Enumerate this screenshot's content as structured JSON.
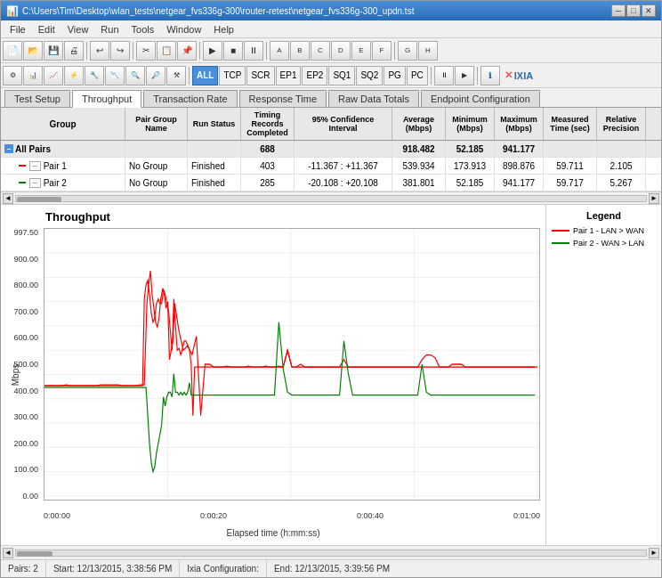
{
  "window": {
    "title": "C:\\Users\\Tim\\Desktop\\wlan_tests\\netgear_fvs336g-300\\router-retest\\netgear_fvs336g-300_updn.tst",
    "title_short": "netgear_fvs336g-300_updn.tst"
  },
  "menu": {
    "items": [
      "File",
      "Edit",
      "View",
      "Run",
      "Tools",
      "Window",
      "Help"
    ]
  },
  "toolbar": {
    "protocols": [
      "ALL",
      "TCP",
      "SCR",
      "EP1",
      "EP2",
      "SQ1",
      "SQ2",
      "PG",
      "PC"
    ],
    "highlighted": "ALL"
  },
  "tabs": {
    "items": [
      "Test Setup",
      "Throughput",
      "Transaction Rate",
      "Response Time",
      "Raw Data Totals",
      "Endpoint Configuration"
    ],
    "active": "Throughput"
  },
  "table": {
    "headers": [
      "Group",
      "Pair Group Name",
      "Run Status",
      "Timing Records Completed",
      "95% Confidence Interval",
      "Average (Mbps)",
      "Minimum (Mbps)",
      "Maximum (Mbps)",
      "Measured Time (sec)",
      "Relative Precision"
    ],
    "all_pairs_row": {
      "group": "All Pairs",
      "timing": "688",
      "average": "918.482",
      "minimum": "52.185",
      "maximum": "941.177"
    },
    "data_rows": [
      {
        "pair_num": "Pair 1",
        "pair_group": "No Group",
        "run_status": "Finished",
        "timing": "403",
        "confidence": "-11.367 : +11.367",
        "average": "539.934",
        "minimum": "173.913",
        "maximum": "898.876",
        "measured": "59.711",
        "relative": "2.105",
        "color": "red"
      },
      {
        "pair_num": "Pair 2",
        "pair_group": "No Group",
        "run_status": "Finished",
        "timing": "285",
        "confidence": "-20.108 : +20.108",
        "average": "381.801",
        "minimum": "52.185",
        "maximum": "941.177",
        "measured": "59.717",
        "relative": "5.267",
        "color": "green"
      }
    ]
  },
  "chart": {
    "title": "Throughput",
    "y_axis_label": "Mbps",
    "x_axis_label": "Elapsed time (h:mm:ss)",
    "y_ticks": [
      "997.50",
      "900.00",
      "800.00",
      "700.00",
      "600.00",
      "500.00",
      "400.00",
      "300.00",
      "200.00",
      "100.00",
      "0.00"
    ],
    "x_ticks": [
      "0:00:00",
      "0:00:20",
      "0:00:40",
      "0:01:00"
    ]
  },
  "legend": {
    "title": "Legend",
    "items": [
      {
        "label": "Pair 1 - LAN > WAN",
        "color": "red"
      },
      {
        "label": "Pair 2 - WAN > LAN",
        "color": "green"
      }
    ]
  },
  "status_bar": {
    "pairs": "Pairs: 2",
    "start": "Start: 12/13/2015, 3:38:56 PM",
    "ixia_config": "Ixia Configuration:",
    "end": "End: 12/13/2015, 3:39:56 PM"
  }
}
